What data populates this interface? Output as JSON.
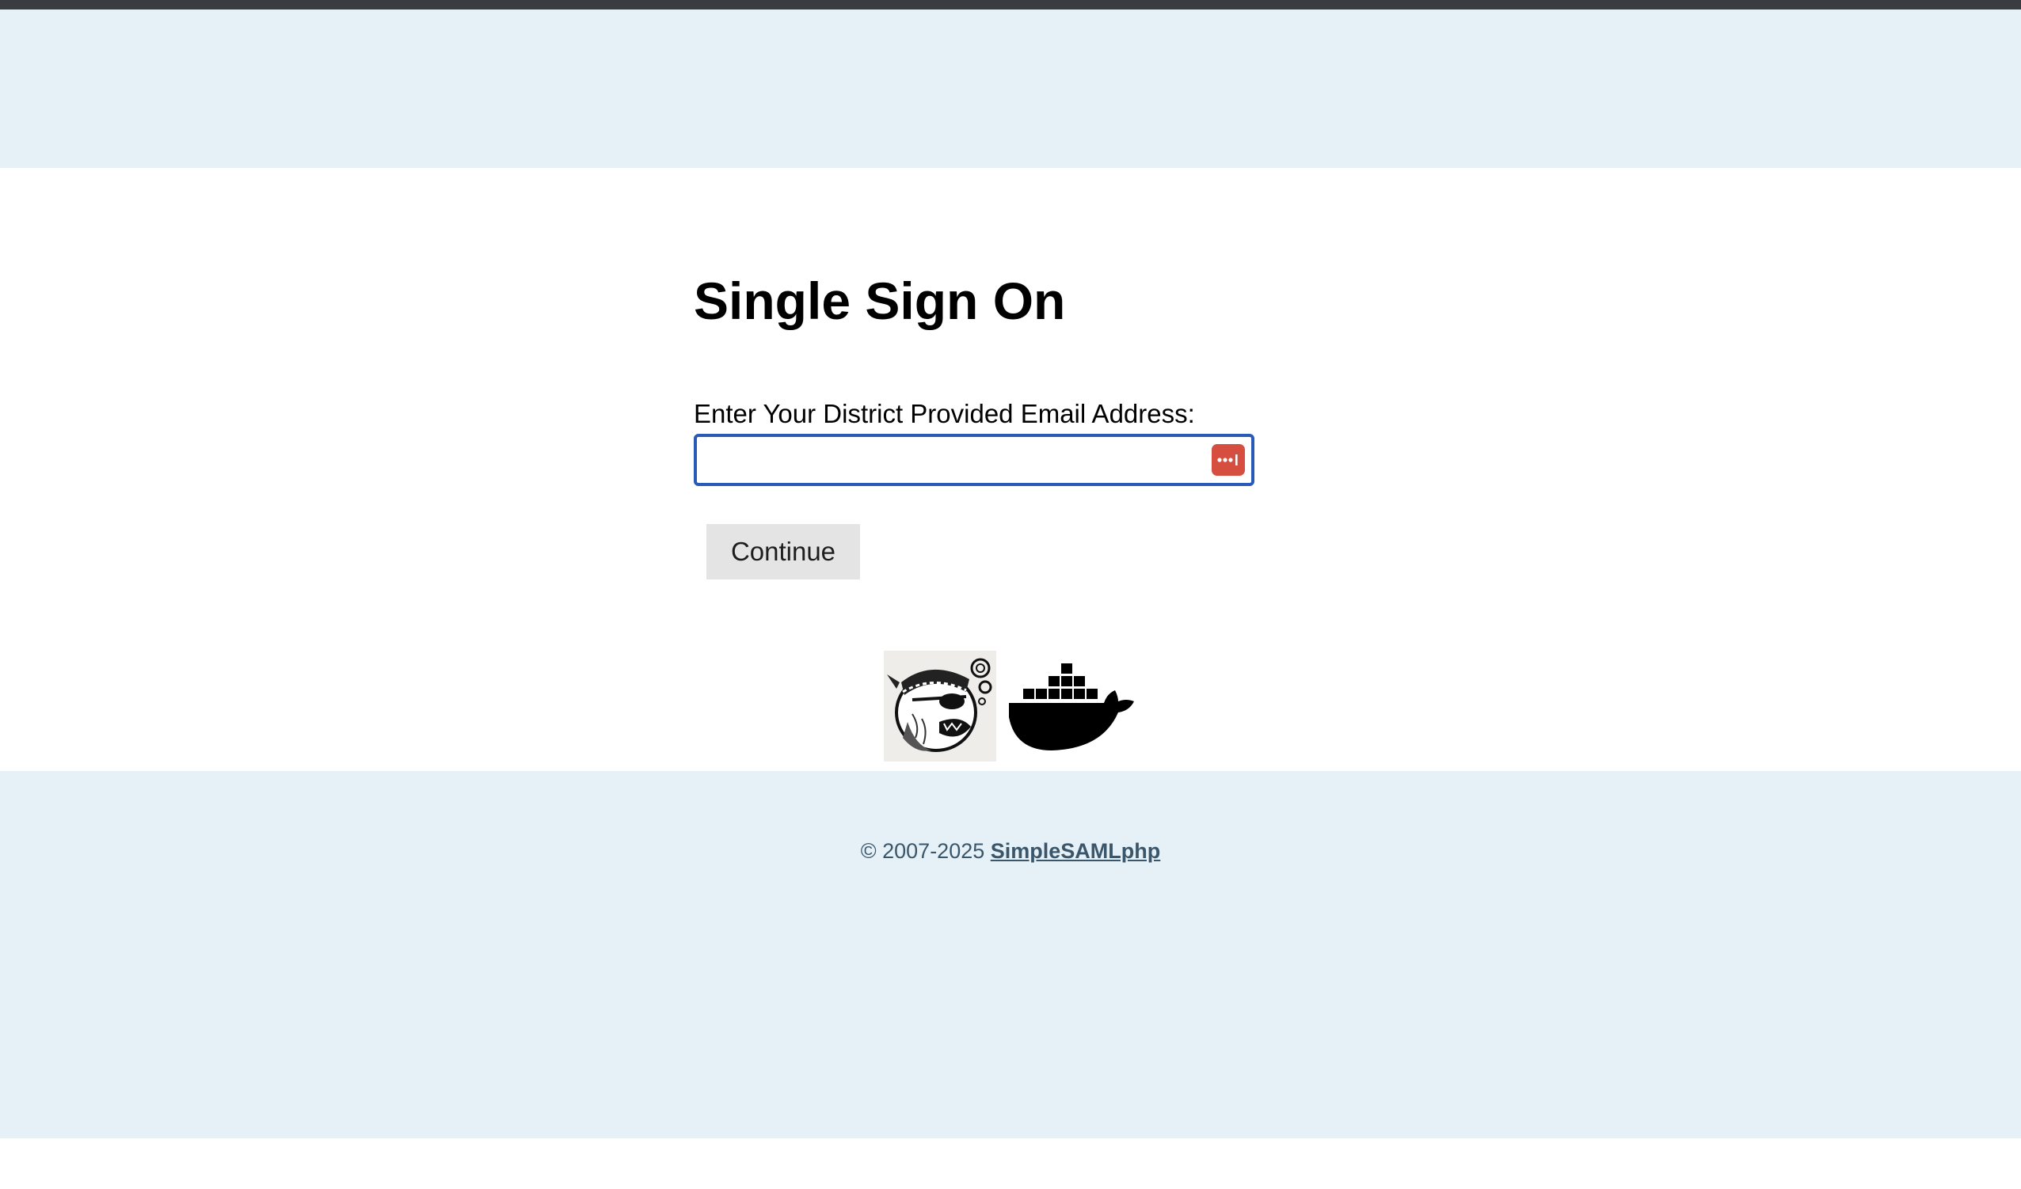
{
  "page": {
    "title": "Single Sign On"
  },
  "form": {
    "email_label": "Enter Your District Provided Email Address:",
    "email_value": "",
    "email_placeholder": "",
    "continue_label": "Continue",
    "password_manager_icon": "password-manager-icon"
  },
  "logos": {
    "left": "simplesamlphp-mascot-logo",
    "right": "docker-whale-logo"
  },
  "footer": {
    "copyright": "© 2007-2025",
    "link_text": "SimpleSAMLphp"
  },
  "colors": {
    "band": "#e5f0f7",
    "focus_border": "#2a5ab8",
    "pw_icon": "#d54e3f",
    "footer_text": "#3a566b",
    "button_bg": "#e4e4e4"
  }
}
